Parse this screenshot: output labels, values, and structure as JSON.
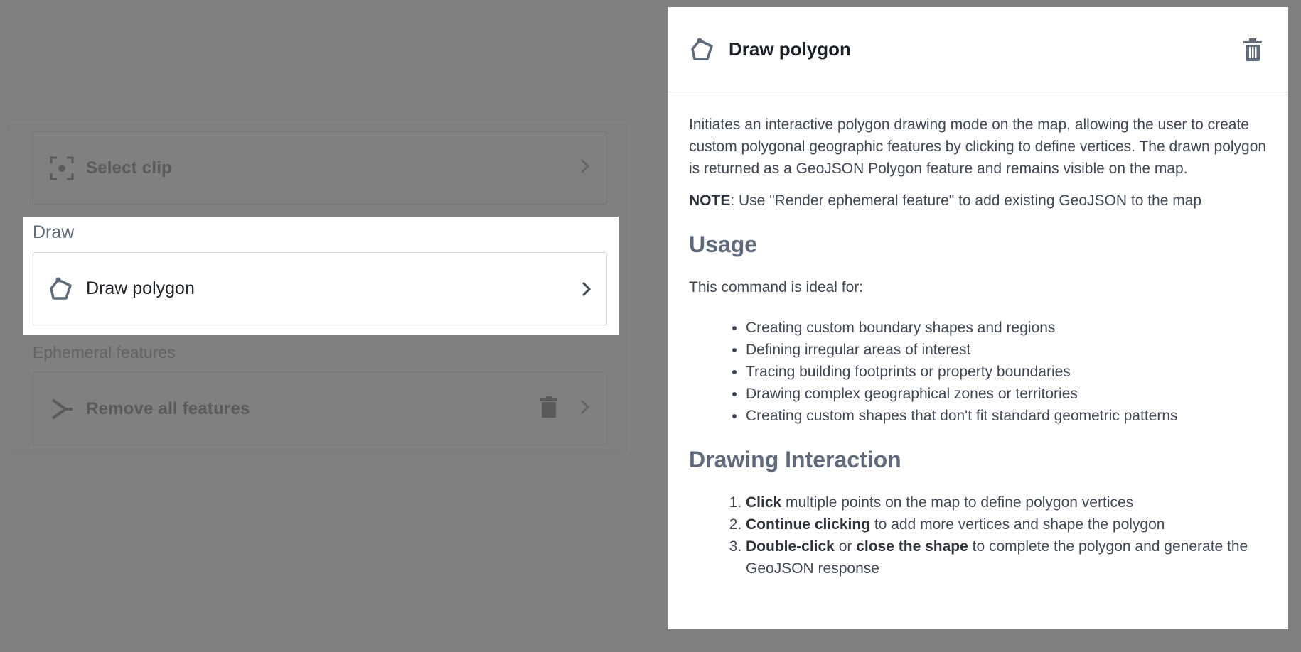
{
  "list": {
    "select_clip_label": "Select clip",
    "draw_section": "Draw",
    "draw_polygon_label": "Draw polygon",
    "ephemeral_section": "Ephemeral features",
    "remove_all_label": "Remove all features"
  },
  "detail": {
    "title": "Draw polygon",
    "intro": "Initiates an interactive polygon drawing mode on the map, allowing the user to create custom polygonal geographic features by clicking to define vertices. The drawn polygon is returned as a GeoJSON Polygon feature and remains visible on the map.",
    "note_label": "NOTE",
    "note_text": ": Use \"Render ephemeral feature\" to add existing GeoJSON to the map",
    "usage_heading": "Usage",
    "usage_intro": "This command is ideal for:",
    "usage_items": [
      "Creating custom boundary shapes and regions",
      "Defining irregular areas of interest",
      "Tracing building footprints or property boundaries",
      "Drawing complex geographical zones or territories",
      "Creating custom shapes that don't fit standard geometric patterns"
    ],
    "interaction_heading": "Drawing Interaction",
    "steps": [
      {
        "bold": "Click",
        "text": " multiple points on the map to define polygon vertices"
      },
      {
        "bold": "Continue clicking",
        "text": " to add more vertices and shape the polygon"
      },
      {
        "bold": "Double-click",
        "mid": " or ",
        "bold2": "close the shape",
        "text": " to complete the polygon and generate the GeoJSON response"
      }
    ]
  },
  "icons": {
    "list_row_icons": [
      "select-clip-icon",
      "polygon-icon",
      "remove-features-icon",
      "trash-icon",
      "chevron-right-icon"
    ],
    "detail_icons": [
      "polygon-icon",
      "trash-icon"
    ]
  },
  "colors": {
    "overlay": "#808080",
    "text_primary": "#1c2127",
    "text_muted": "#5f6b7a",
    "icon": "#5f6b7a"
  }
}
